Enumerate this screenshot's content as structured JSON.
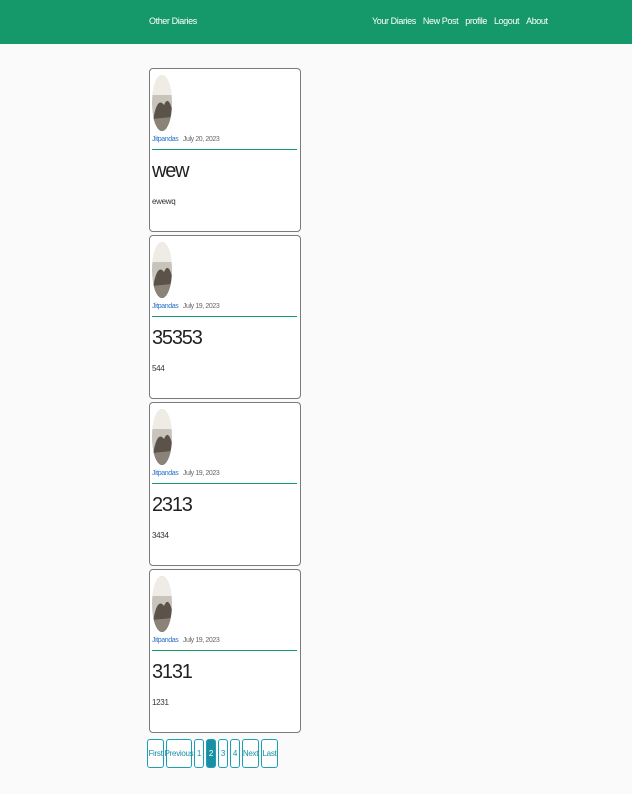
{
  "navbar": {
    "brand": "Other Diaries",
    "links": [
      "Your Diaries",
      "New Post",
      "profile",
      "Logout",
      "About"
    ]
  },
  "posts": [
    {
      "author": "Jitpandas",
      "date": "July 20, 2023",
      "title": "wew",
      "content": "ewewq"
    },
    {
      "author": "Jitpandas",
      "date": "July 19, 2023",
      "title": "35353",
      "content": "544"
    },
    {
      "author": "Jitpandas",
      "date": "July 19, 2023",
      "title": "2313",
      "content": "3434"
    },
    {
      "author": "Jitpandas",
      "date": "July 19, 2023",
      "title": "3131",
      "content": "1231"
    }
  ],
  "pagination": {
    "first": "First",
    "previous": "Previous",
    "pages": [
      "1",
      "2",
      "3",
      "4"
    ],
    "current": "2",
    "next": "Next",
    "last": "Last"
  },
  "colors": {
    "navbar_bg": "#16996a",
    "accent_rule": "#16996a",
    "link": "#2a73c9",
    "pagination": "#1a8fa3"
  }
}
